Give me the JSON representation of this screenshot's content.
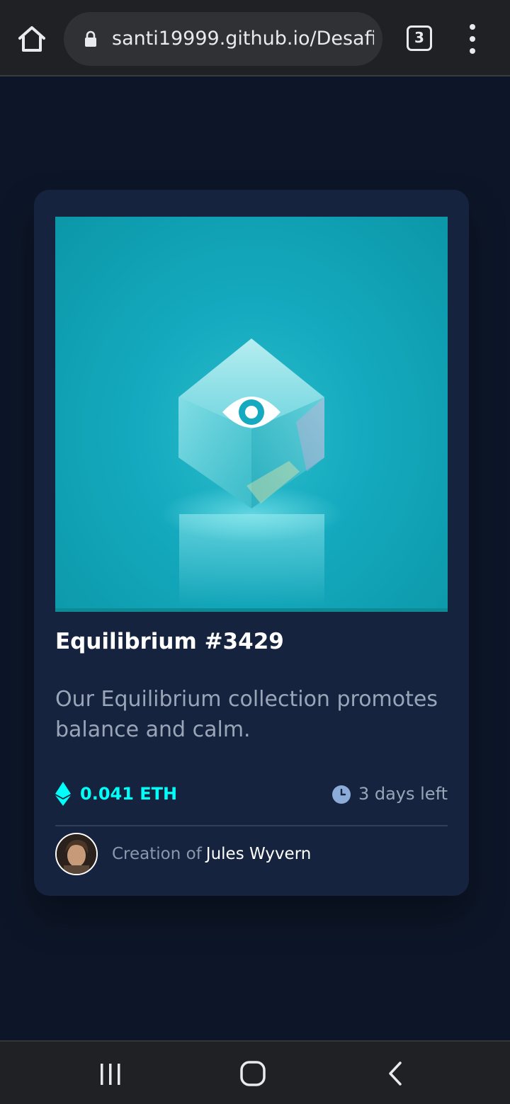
{
  "browser": {
    "url": "santi19999.github.io/Desafi",
    "tab_count": "3",
    "icons": {
      "home": "home-icon",
      "lock": "lock-icon",
      "menu": "more-vert-icon"
    }
  },
  "card": {
    "title": "Equilibrium #3429",
    "description": "Our Equilibrium collection promotes balance and calm.",
    "price": "0.041 ETH",
    "time_left": "3 days left",
    "creator_prefix": "Creation of",
    "creator_name": "Jules Wyvern",
    "icons": {
      "image_overlay": "eye-icon",
      "price": "ethereum-icon",
      "time": "clock-icon"
    }
  },
  "system_nav": {
    "icons": [
      "recents-icon",
      "home-circle-icon",
      "back-icon"
    ]
  },
  "colors": {
    "page_bg": "#0d1628",
    "card_bg": "#15233f",
    "accent_cyan": "#00fff8",
    "soft_blue": "#8bacd9",
    "white": "#ffffff",
    "browser_bar": "#202124"
  }
}
